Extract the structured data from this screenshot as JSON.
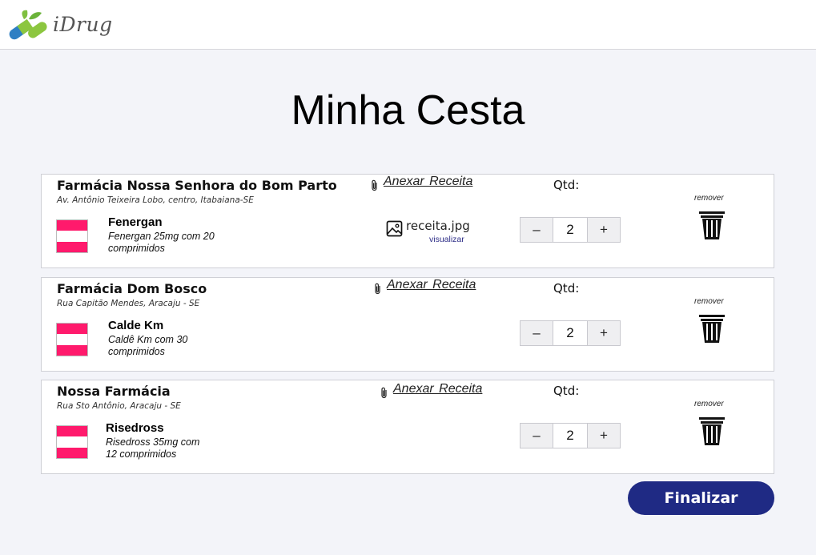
{
  "app": {
    "logo_text": "iDrug"
  },
  "page": {
    "title": "Minha Cesta"
  },
  "cart": {
    "items": [
      {
        "pharmacy": "Farmácia Nossa Senhora do Bom Parto",
        "address": "Av. Antônio Teixeira Lobo, centro, Itabaiana-SE",
        "attach_label": "Anexar  Receita",
        "receipt_file": "receita.jpg",
        "receipt_view": "visualizar",
        "medicine": "Fenergan",
        "description": "Fenergan 25mg com 20 comprimidos",
        "qty_label": "Qtd:",
        "qty": "2",
        "minus": "–",
        "plus": "+",
        "remove_label": "remover"
      },
      {
        "pharmacy": "Farmácia Dom Bosco",
        "address": "Rua Capitão Mendes, Aracaju - SE",
        "attach_label": "Anexar  Receita",
        "medicine": "Calde Km",
        "description": "Caldê Km com 30 comprimidos",
        "qty_label": "Qtd:",
        "qty": "2",
        "minus": "–",
        "plus": "+",
        "remove_label": "remover"
      },
      {
        "pharmacy": "Nossa Farmácia",
        "address": "Rua Sto Antônio, Aracaju - SE",
        "attach_label": "Anexar  Receita",
        "medicine": "Risedross",
        "description": "Risedross 35mg com 12 comprimidos",
        "qty_label": "Qtd:",
        "qty": "2",
        "minus": "–",
        "plus": "+",
        "remove_label": "remover"
      }
    ]
  },
  "actions": {
    "finalize_label": "Finalizar"
  },
  "colors": {
    "brand": "#1f2a84",
    "flag_accent": "#ff1a6c",
    "background": "#f3f4f9"
  },
  "icons": [
    "pill-logo-icon",
    "paperclip-icon",
    "image-icon",
    "trash-icon"
  ]
}
